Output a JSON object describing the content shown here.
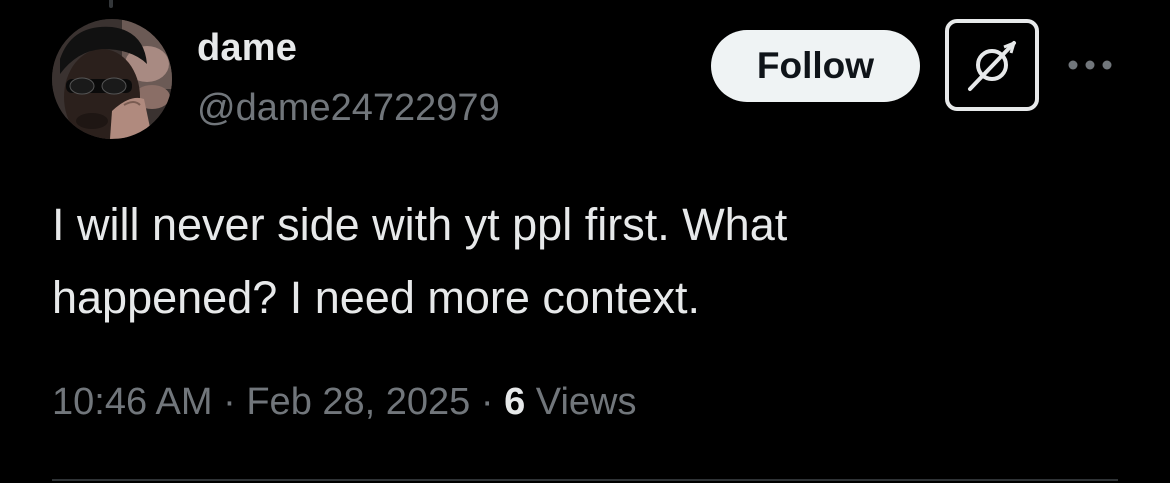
{
  "author": {
    "display_name": "dame",
    "handle": "@dame24722979"
  },
  "actions": {
    "follow_label": "Follow",
    "grok_icon": "grok-icon",
    "more_icon": "more-dots-icon"
  },
  "tweet": {
    "text": "I will never side with yt ppl first. What\nhappened? I need more context."
  },
  "meta": {
    "time": "10:46 AM",
    "separator": "·",
    "date": "Feb 28, 2025",
    "views_count": "6",
    "views_label": "Views"
  },
  "colors": {
    "background": "#000000",
    "primary_text": "#e7e9ea",
    "secondary_text": "#71767b",
    "follow_bg": "#eff3f4",
    "follow_text": "#0f1419",
    "divider": "#2f3336"
  }
}
